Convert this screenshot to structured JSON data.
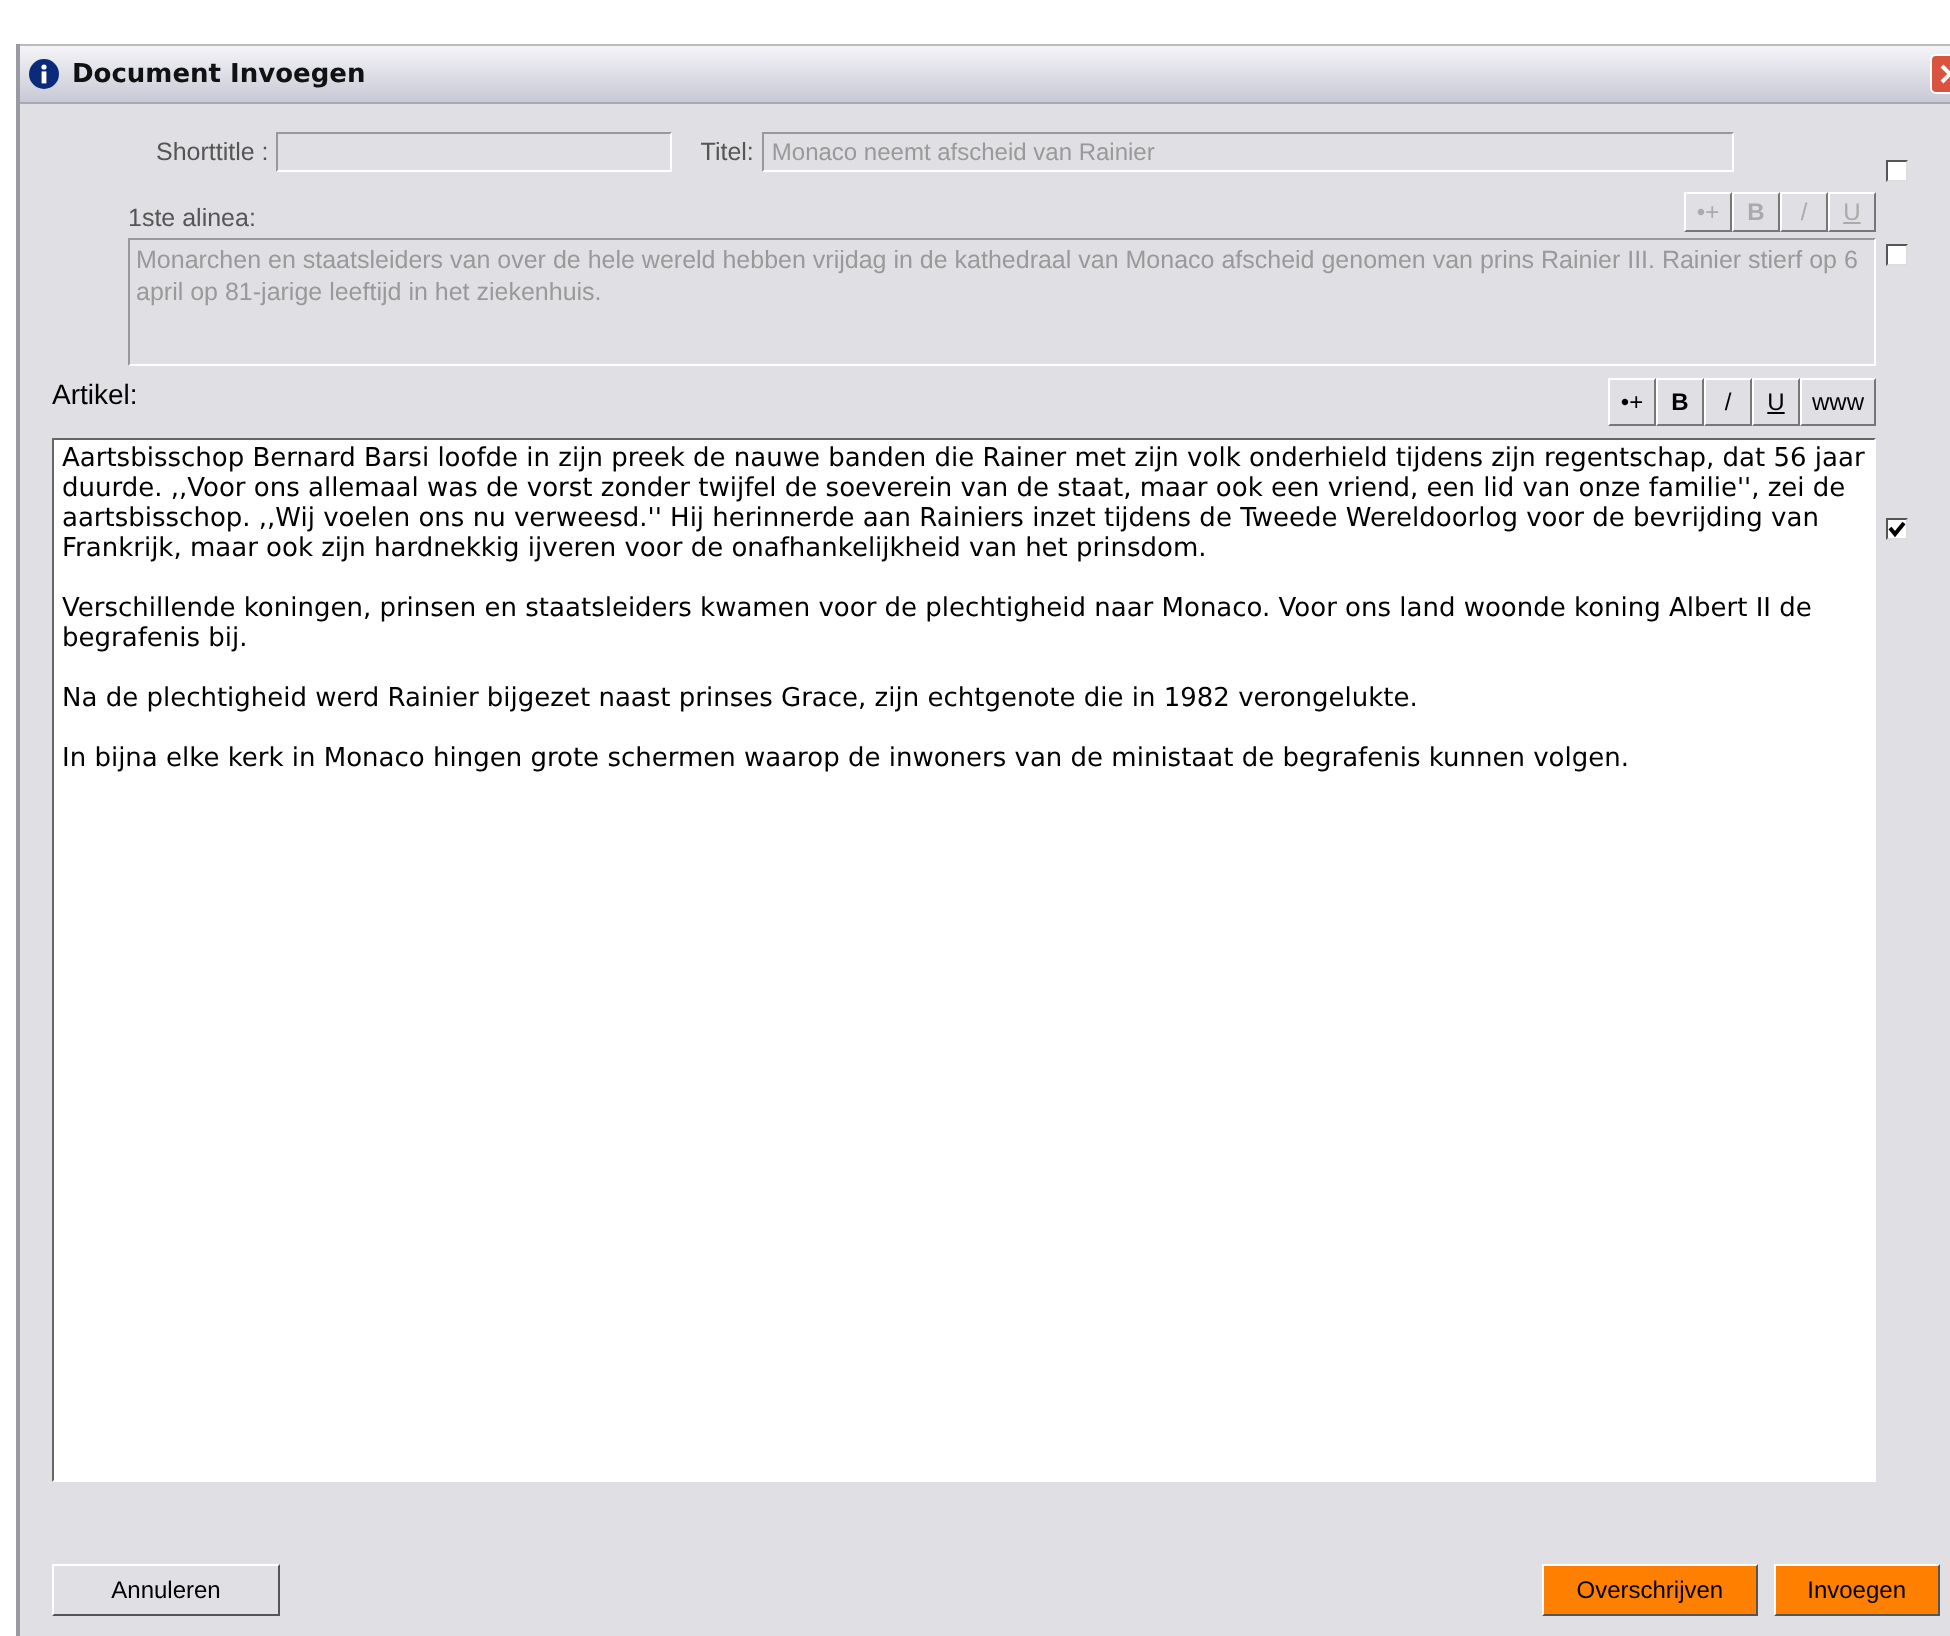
{
  "window": {
    "title": "Document Invoegen"
  },
  "shorttitle": {
    "label": "Shorttitle :",
    "disabled": true
  },
  "titel": {
    "label": "Titel:",
    "value": "Monaco neemt afscheid van Rainier",
    "disabled": true
  },
  "alinea": {
    "label": "1ste alinea:",
    "disabled": true,
    "value": "Monarchen en staatsleiders van over de hele wereld hebben vrijdag in de kathedraal van Monaco afscheid genomen van prins Rainier III. Rainier stierf op 6 april op 81-jarige leeftijd in het ziekenhuis.",
    "toolbar": [
      {
        "kind": "bullet",
        "label": "•+"
      },
      {
        "kind": "bold",
        "label": "B"
      },
      {
        "kind": "italic",
        "label": "/"
      },
      {
        "kind": "underline",
        "label": "U"
      }
    ]
  },
  "artikel": {
    "label": "Artikel:",
    "disabled": false,
    "toolbar": [
      {
        "kind": "bullet",
        "label": "•+"
      },
      {
        "kind": "bold",
        "label": "B"
      },
      {
        "kind": "italic",
        "label": "/"
      },
      {
        "kind": "underline",
        "label": "U"
      },
      {
        "kind": "link",
        "label": "www"
      }
    ],
    "paragraphs": [
      "Aartsbisschop Bernard Barsi loofde in zijn preek de nauwe banden die Rainer met zijn volk onderhield tijdens zijn regentschap, dat 56 jaar duurde. ,,Voor ons allemaal was de vorst zonder twijfel de soeverein van de staat, maar ook een vriend, een lid van onze familie'', zei de aartsbisschop. ,,Wij voelen ons nu verweesd.'' Hij herinnerde aan Rainiers inzet tijdens de Tweede Wereldoorlog voor de bevrijding van Frankrijk, maar ook zijn hardnekkig ijveren voor de onafhankelijkheid van het prinsdom.",
      "Verschillende koningen, prinsen en staatsleiders kwamen voor de plechtigheid naar Monaco. Voor ons land woonde koning Albert II de begrafenis bij.",
      "Na de plechtigheid werd Rainier bijgezet naast prinses Grace, zijn echtgenote die in 1982 verongelukte.",
      "In bijna elke kerk in Monaco hingen grote schermen waarop de inwoners van de ministaat de begrafenis kunnen volgen."
    ]
  },
  "checkboxes": [
    {
      "checked": false
    },
    {
      "checked": false
    },
    {
      "checked": true
    }
  ],
  "buttons": [
    {
      "label": "Annuleren",
      "kind": "plain"
    },
    {
      "label": "Overschrijven",
      "kind": "accent"
    },
    {
      "label": "Invoegen",
      "kind": "accent"
    }
  ]
}
